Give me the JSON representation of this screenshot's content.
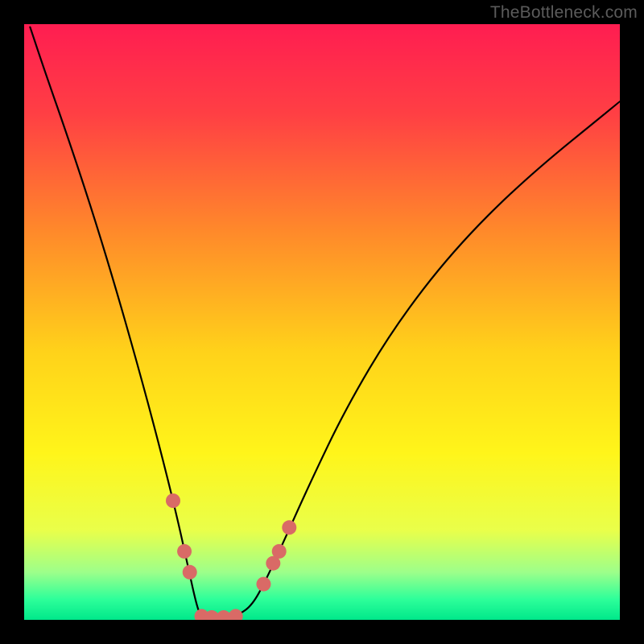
{
  "watermark": "TheBottleneck.com",
  "chart_data": {
    "type": "line",
    "title": "",
    "xlabel": "",
    "ylabel": "",
    "xlim": [
      0,
      100
    ],
    "ylim": [
      0,
      100
    ],
    "gradient_stops": [
      {
        "offset": 0.0,
        "color": "#ff1d51"
      },
      {
        "offset": 0.15,
        "color": "#ff3f44"
      },
      {
        "offset": 0.35,
        "color": "#ff8a2a"
      },
      {
        "offset": 0.55,
        "color": "#ffd21a"
      },
      {
        "offset": 0.72,
        "color": "#fff51a"
      },
      {
        "offset": 0.85,
        "color": "#e9ff4a"
      },
      {
        "offset": 0.92,
        "color": "#9dff8a"
      },
      {
        "offset": 0.965,
        "color": "#2eff9a"
      },
      {
        "offset": 1.0,
        "color": "#00e88a"
      }
    ],
    "series": [
      {
        "name": "bottleneck-curve",
        "x": [
          1.0,
          3.5,
          7.0,
          11.0,
          15.0,
          19.0,
          22.5,
          25.5,
          27.5,
          28.7,
          29.5,
          30.2,
          33.5,
          36.0,
          38.3,
          40.5,
          43.5,
          48.0,
          54.0,
          62.0,
          72.0,
          84.0,
          100.0
        ],
        "y": [
          99.5,
          92.0,
          82.0,
          70.0,
          57.0,
          43.0,
          30.0,
          18.0,
          9.0,
          3.5,
          0.8,
          0.4,
          0.4,
          0.8,
          2.5,
          6.5,
          13.0,
          23.0,
          35.5,
          49.0,
          62.0,
          74.0,
          87.0
        ]
      }
    ],
    "markers": {
      "name": "highlight-points",
      "color": "#d96a66",
      "r": 9,
      "points": [
        {
          "x": 25.0,
          "y": 20.0
        },
        {
          "x": 26.9,
          "y": 11.5
        },
        {
          "x": 27.8,
          "y": 8.0
        },
        {
          "x": 29.8,
          "y": 0.6
        },
        {
          "x": 31.5,
          "y": 0.4
        },
        {
          "x": 33.5,
          "y": 0.4
        },
        {
          "x": 35.5,
          "y": 0.6
        },
        {
          "x": 40.2,
          "y": 6.0
        },
        {
          "x": 41.8,
          "y": 9.5
        },
        {
          "x": 42.8,
          "y": 11.5
        },
        {
          "x": 44.5,
          "y": 15.5
        }
      ]
    }
  }
}
